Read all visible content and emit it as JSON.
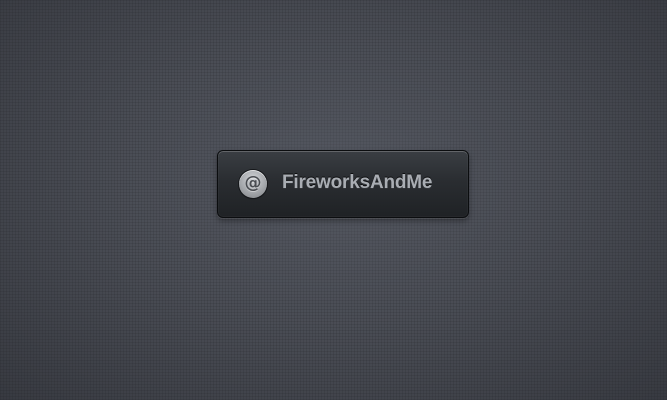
{
  "button": {
    "label": "FireworksAndMe",
    "icon": "at-sign-icon",
    "icon_glyph": "@"
  },
  "colors": {
    "background": "#4a4d55",
    "button_body": "#2a2d31",
    "label_text": "#a9adb3",
    "icon_circle": "#a4a7ab"
  }
}
